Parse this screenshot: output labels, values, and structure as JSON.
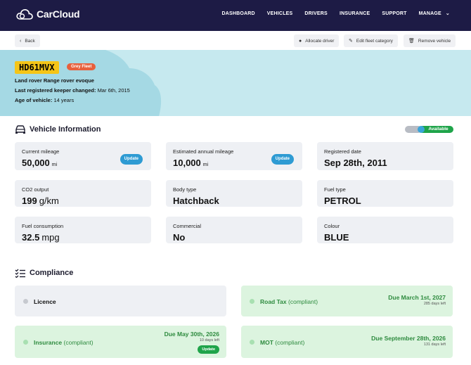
{
  "app": {
    "name": "CarCloud"
  },
  "nav": {
    "items": [
      {
        "label": "DASHBOARD"
      },
      {
        "label": "VEHICLES"
      },
      {
        "label": "DRIVERS"
      },
      {
        "label": "INSURANCE"
      },
      {
        "label": "SUPPORT"
      },
      {
        "label": "MANAGE"
      }
    ]
  },
  "actions": {
    "back": "Back",
    "allocate": "Allocate driver",
    "edit_category": "Edit fleet category",
    "remove": "Remove vehicle"
  },
  "vehicle": {
    "plate": "HD61MVX",
    "fleet": "Grey Fleet",
    "model": "Land rover Range rover evoque",
    "keeper_label": "Last registered keeper changed:",
    "keeper_value": "Mar 6th, 2015",
    "age_label": "Age of vehicle:",
    "age_value": "14 years"
  },
  "info_section": {
    "title": "Vehicle Information",
    "status": "Available",
    "cards": [
      {
        "label": "Current mileage",
        "value": "50,000",
        "unit": "mi",
        "button": "Update"
      },
      {
        "label": "Estimated annual mileage",
        "value": "10,000",
        "unit": "mi",
        "button": "Update"
      },
      {
        "label": "Registered date",
        "value": "Sep 28th, 2011"
      },
      {
        "label": "CO2 output",
        "value": "199",
        "unit": "g/km"
      },
      {
        "label": "Body type",
        "value": "Hatchback"
      },
      {
        "label": "Fuel type",
        "value": "PETROL"
      },
      {
        "label": "Fuel consumption",
        "value": "32.5",
        "unit": "mpg"
      },
      {
        "label": "Commercial",
        "value": "No"
      },
      {
        "label": "Colour",
        "value": "BLUE"
      }
    ]
  },
  "compliance": {
    "title": "Compliance",
    "items": [
      {
        "name": "Licence",
        "status": "",
        "due": "",
        "left": ""
      },
      {
        "name": "Road Tax",
        "status": "(compliant)",
        "due": "Due March 1st, 2027",
        "left": "285 days left"
      },
      {
        "name": "Insurance",
        "status": "(compliant)",
        "due": "Due May 30th, 2026",
        "left": "10 days left",
        "button": "Update"
      },
      {
        "name": "MOT",
        "status": "(compliant)",
        "due": "Due September 28th, 2026",
        "left": "131 days left"
      }
    ]
  },
  "colors": {
    "nav_bg": "#1d1b45",
    "hero_bg": "#c6e9ef",
    "plate": "#f5c518",
    "fleet_badge": "#e8603c",
    "update_blue": "#2e9bd3",
    "available_green": "#1fa44a",
    "compliant_card": "#dcf4df"
  }
}
